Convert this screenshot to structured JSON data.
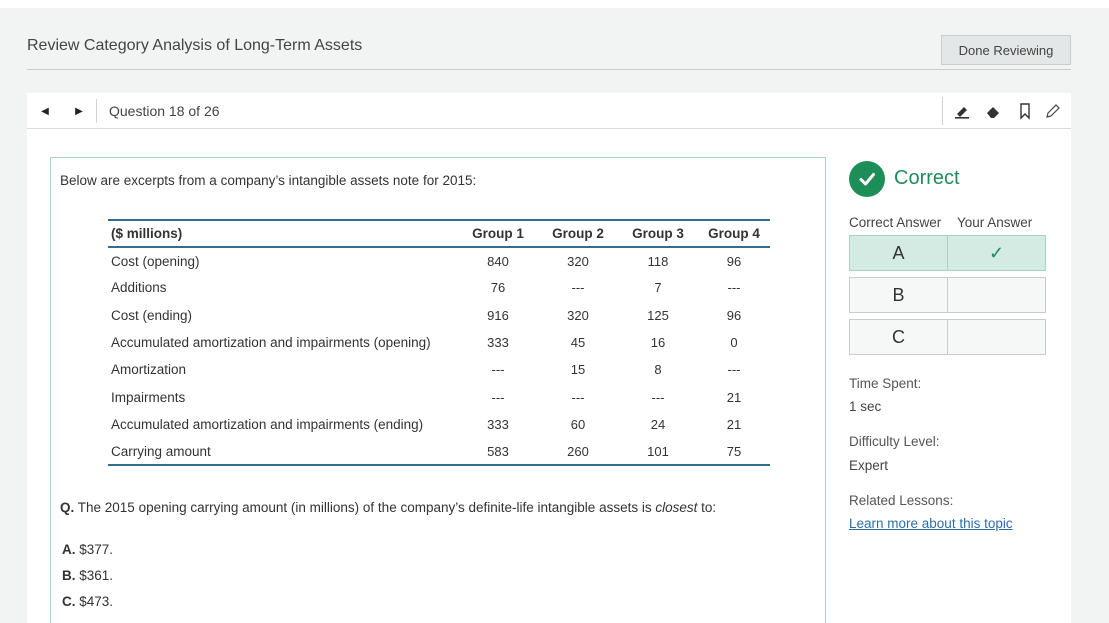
{
  "header": {
    "title": "Review Category Analysis of Long-Term Assets",
    "done_label": "Done Reviewing"
  },
  "question_bar": {
    "prev_icon": "◀",
    "next_icon": "▶",
    "counter": "Question 18 of 26",
    "tools": [
      "highlighter-icon",
      "eraser-icon",
      "bookmark-icon",
      "pencil-icon"
    ]
  },
  "question": {
    "intro": "Below are excerpts from a company’s intangible assets note for 2015:",
    "table": {
      "headers": [
        "($ millions)",
        "Group 1",
        "Group 2",
        "Group 3",
        "Group 4"
      ],
      "rows": [
        [
          "Cost (opening)",
          "840",
          "320",
          "118",
          "96"
        ],
        [
          "Additions",
          "76",
          "---",
          "7",
          "---"
        ],
        [
          "Cost (ending)",
          "916",
          "320",
          "125",
          "96"
        ],
        [
          "Accumulated amortization and impairments (opening)",
          "333",
          "45",
          "16",
          "0"
        ],
        [
          "Amortization",
          "---",
          "15",
          "8",
          "---"
        ],
        [
          "Impairments",
          "---",
          "---",
          "---",
          "21"
        ],
        [
          "Accumulated amortization and impairments (ending)",
          "333",
          "60",
          "24",
          "21"
        ],
        [
          "Carrying amount",
          "583",
          "260",
          "101",
          "75"
        ]
      ]
    },
    "q_prefix": "Q.",
    "q_text_before": " The 2015 opening carrying amount (in millions) of the company’s definite-life intangible assets is ",
    "q_text_emph": "closest",
    "q_text_after": " to:",
    "options": [
      {
        "letter": "A.",
        "text": " $377."
      },
      {
        "letter": "B.",
        "text": " $361."
      },
      {
        "letter": "C.",
        "text": " $473."
      }
    ]
  },
  "result": {
    "status": "Correct",
    "col_correct": "Correct Answer",
    "col_yours": "Your Answer",
    "rows": [
      {
        "letter": "A",
        "mark": "✓"
      },
      {
        "letter": "B",
        "mark": ""
      },
      {
        "letter": "C",
        "mark": ""
      }
    ],
    "time_label": "Time Spent:",
    "time_value": "1 sec",
    "difficulty_label": "Difficulty Level:",
    "difficulty_value": "Expert",
    "lessons_label": "Related Lessons:",
    "lessons_link": "Learn more about this topic"
  },
  "colors": {
    "accent_green": "#1e8e58",
    "table_rule": "#2d6f8d",
    "link": "#2a6fa8",
    "highlight": "#d4ebe3"
  }
}
